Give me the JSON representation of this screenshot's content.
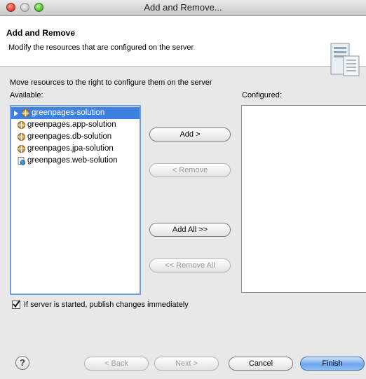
{
  "window": {
    "title": "Add and Remove..."
  },
  "header": {
    "title": "Add and Remove",
    "description": "Modify the resources that are configured on the server"
  },
  "instruction": "Move resources to the right to configure them on the server",
  "available": {
    "label": "Available:",
    "items": [
      {
        "label": "greenpages-solution",
        "icon": "project-bundle-icon",
        "selected": true
      },
      {
        "label": "greenpages.app-solution",
        "icon": "bundle-icon",
        "selected": false
      },
      {
        "label": "greenpages.db-solution",
        "icon": "bundle-icon",
        "selected": false
      },
      {
        "label": "greenpages.jpa-solution",
        "icon": "bundle-icon",
        "selected": false
      },
      {
        "label": "greenpages.web-solution",
        "icon": "web-bundle-icon",
        "selected": false
      }
    ]
  },
  "configured": {
    "label": "Configured:",
    "items": []
  },
  "buttons": {
    "add": "Add >",
    "remove": "< Remove",
    "add_all": "Add All >>",
    "remove_all": "<< Remove All"
  },
  "publish": {
    "label": "If server is started, publish changes immediately",
    "checked": true
  },
  "footer": {
    "help": "?",
    "back": "< Back",
    "next": "Next >",
    "cancel": "Cancel",
    "finish": "Finish"
  },
  "colors": {
    "selection": "#3d80df",
    "focus_ring": "#6d9ee0",
    "default_button": "#6fa7ea"
  }
}
